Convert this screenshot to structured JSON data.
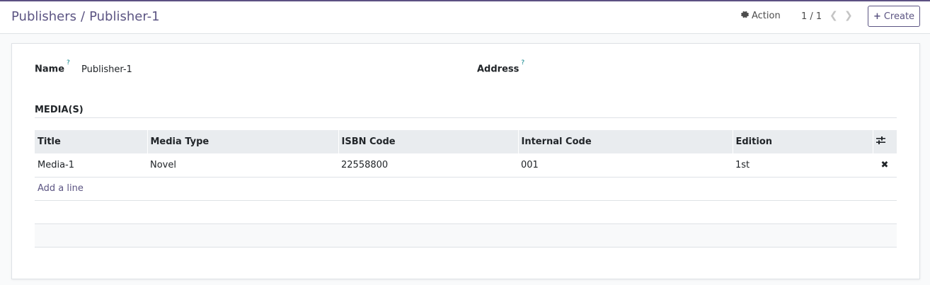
{
  "breadcrumb": {
    "parent": "Publishers",
    "separator": "/",
    "current": "Publisher-1"
  },
  "toolbar": {
    "action_label": "Action",
    "pager": "1 / 1",
    "create_label": "Create"
  },
  "form": {
    "name_label": "Name",
    "name_value": "Publisher-1",
    "address_label": "Address",
    "help_mark": "?"
  },
  "media_section": {
    "title": "MEDIA(S)",
    "columns": [
      "Title",
      "Media Type",
      "ISBN Code",
      "Internal Code",
      "Edition"
    ],
    "rows": [
      {
        "title": "Media-1",
        "media_type": "Novel",
        "isbn": "22558800",
        "internal_code": "001",
        "edition": "1st"
      }
    ],
    "add_line_label": "Add a line"
  },
  "colors": {
    "brand": "#5c5583",
    "help": "#017e84",
    "header_bg": "#e9ecef"
  },
  "icons": [
    "gear-icon",
    "chevron-left-icon",
    "chevron-right-icon",
    "plus-icon",
    "column-options-icon",
    "delete-icon"
  ]
}
